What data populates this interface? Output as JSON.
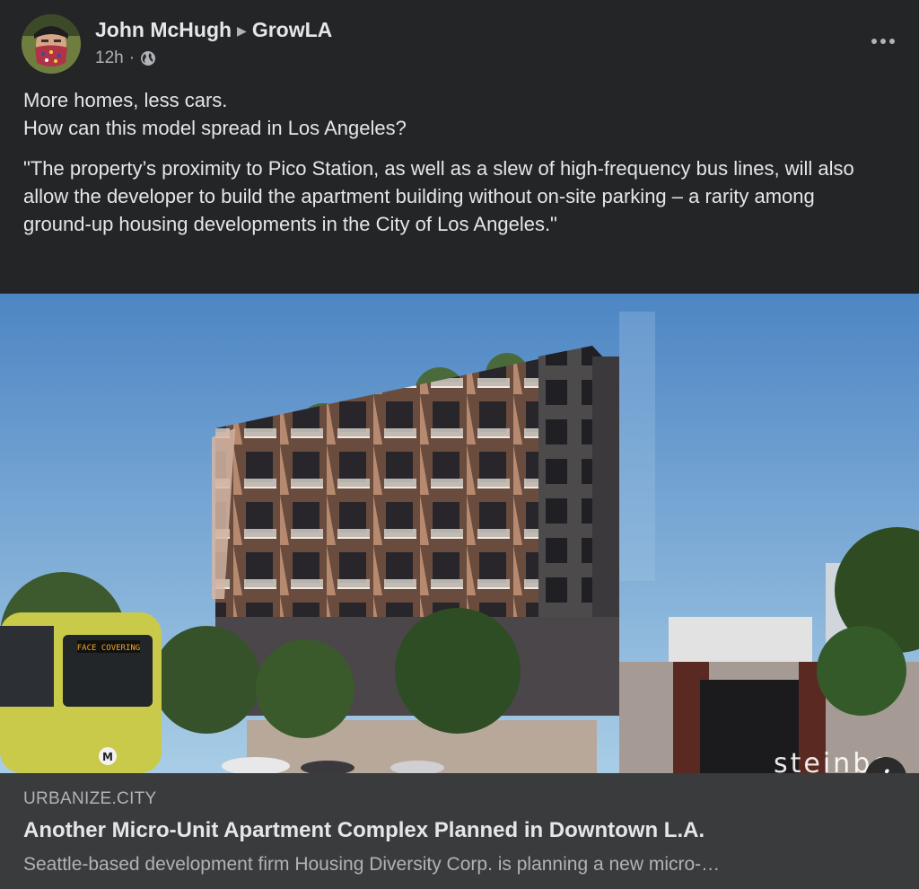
{
  "post": {
    "author": "John McHugh",
    "group": "GrowLA",
    "time": "12h",
    "privacy_icon": "globe-icon",
    "more_icon": "more-dots-icon",
    "text_line1": "More homes, less cars.",
    "text_line2": "How can this model spread in Los Angeles?",
    "quote": "\"The property’s proximity to Pico Station, as well as a slew of high-frequency bus lines, will also allow the developer to build the apartment building without on-site parking – a rarity among ground-up housing developments in the City of Los Angeles.\""
  },
  "link": {
    "domain": "URBANIZE.CITY",
    "title": "Another Micro-Unit Apartment Complex Planned in Downtown L.A.",
    "description": "Seattle-based development firm Housing Diversity Corp. is planning a new micro-…",
    "image_watermark": "steinbe",
    "info_icon": "info-icon",
    "info_label": "i"
  },
  "image_text": {
    "train_sign": "FACE COVERING",
    "train_logo": "M"
  },
  "colors": {
    "background": "#242526",
    "preview_background": "#3a3b3c",
    "primary_text": "#e4e6eb",
    "secondary_text": "#b0b3b8"
  }
}
